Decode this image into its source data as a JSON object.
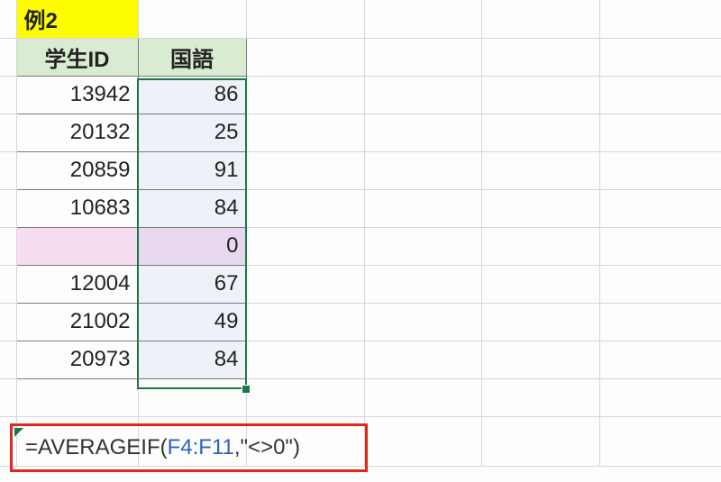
{
  "title": "例2",
  "headers": {
    "col1": "学生ID",
    "col2": "国語"
  },
  "rows": [
    {
      "id": "13942",
      "score": "86"
    },
    {
      "id": "20132",
      "score": "25"
    },
    {
      "id": "20859",
      "score": "91"
    },
    {
      "id": "10683",
      "score": "84"
    },
    {
      "id": "",
      "score": "0"
    },
    {
      "id": "12004",
      "score": "67"
    },
    {
      "id": "21002",
      "score": "49"
    },
    {
      "id": "20973",
      "score": "84"
    }
  ],
  "formula": {
    "eq": "=",
    "fn": "AVERAGEIF",
    "open": "(",
    "ref": "F4:F11",
    "rest": ",\"<>0\")"
  }
}
